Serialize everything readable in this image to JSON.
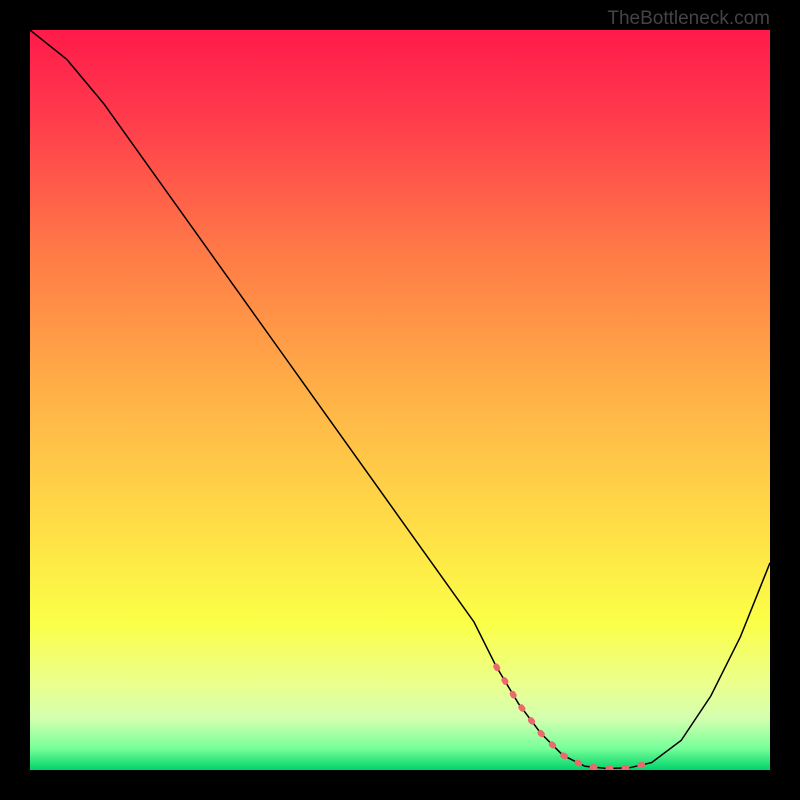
{
  "watermark": "TheBottleneck.com",
  "chart_data": {
    "type": "line",
    "title": "",
    "xlabel": "",
    "ylabel": "",
    "xlim": [
      0,
      100
    ],
    "ylim": [
      0,
      100
    ],
    "background_gradient": {
      "stops": [
        {
          "pos": 0.0,
          "color": "#ff1a4a"
        },
        {
          "pos": 0.12,
          "color": "#ff3c4c"
        },
        {
          "pos": 0.3,
          "color": "#ff7a47"
        },
        {
          "pos": 0.5,
          "color": "#ffb347"
        },
        {
          "pos": 0.68,
          "color": "#ffe047"
        },
        {
          "pos": 0.8,
          "color": "#fbff47"
        },
        {
          "pos": 0.88,
          "color": "#ecff8a"
        },
        {
          "pos": 0.93,
          "color": "#d4ffb0"
        },
        {
          "pos": 0.97,
          "color": "#7aff9a"
        },
        {
          "pos": 1.0,
          "color": "#00d46a"
        }
      ]
    },
    "series": [
      {
        "name": "bottleneck-curve",
        "color": "#000000",
        "stroke_width": 1.5,
        "x": [
          0,
          5,
          10,
          15,
          20,
          25,
          30,
          35,
          40,
          45,
          50,
          55,
          60,
          63,
          66,
          69,
          72,
          75,
          78,
          81,
          84,
          88,
          92,
          96,
          100
        ],
        "y": [
          100,
          96,
          90,
          83,
          76,
          69,
          62,
          55,
          48,
          41,
          34,
          27,
          20,
          14,
          9,
          5,
          2,
          0.5,
          0.2,
          0.3,
          1,
          4,
          10,
          18,
          28
        ]
      }
    ],
    "highlight_segment": {
      "name": "optimal-range-marker",
      "color": "#e86a6a",
      "stroke_width": 6,
      "dash": true,
      "x": [
        63,
        66,
        69,
        72,
        75,
        78,
        81,
        84
      ],
      "y": [
        14,
        9,
        5,
        2,
        0.5,
        0.2,
        0.3,
        1,
        4
      ]
    }
  }
}
